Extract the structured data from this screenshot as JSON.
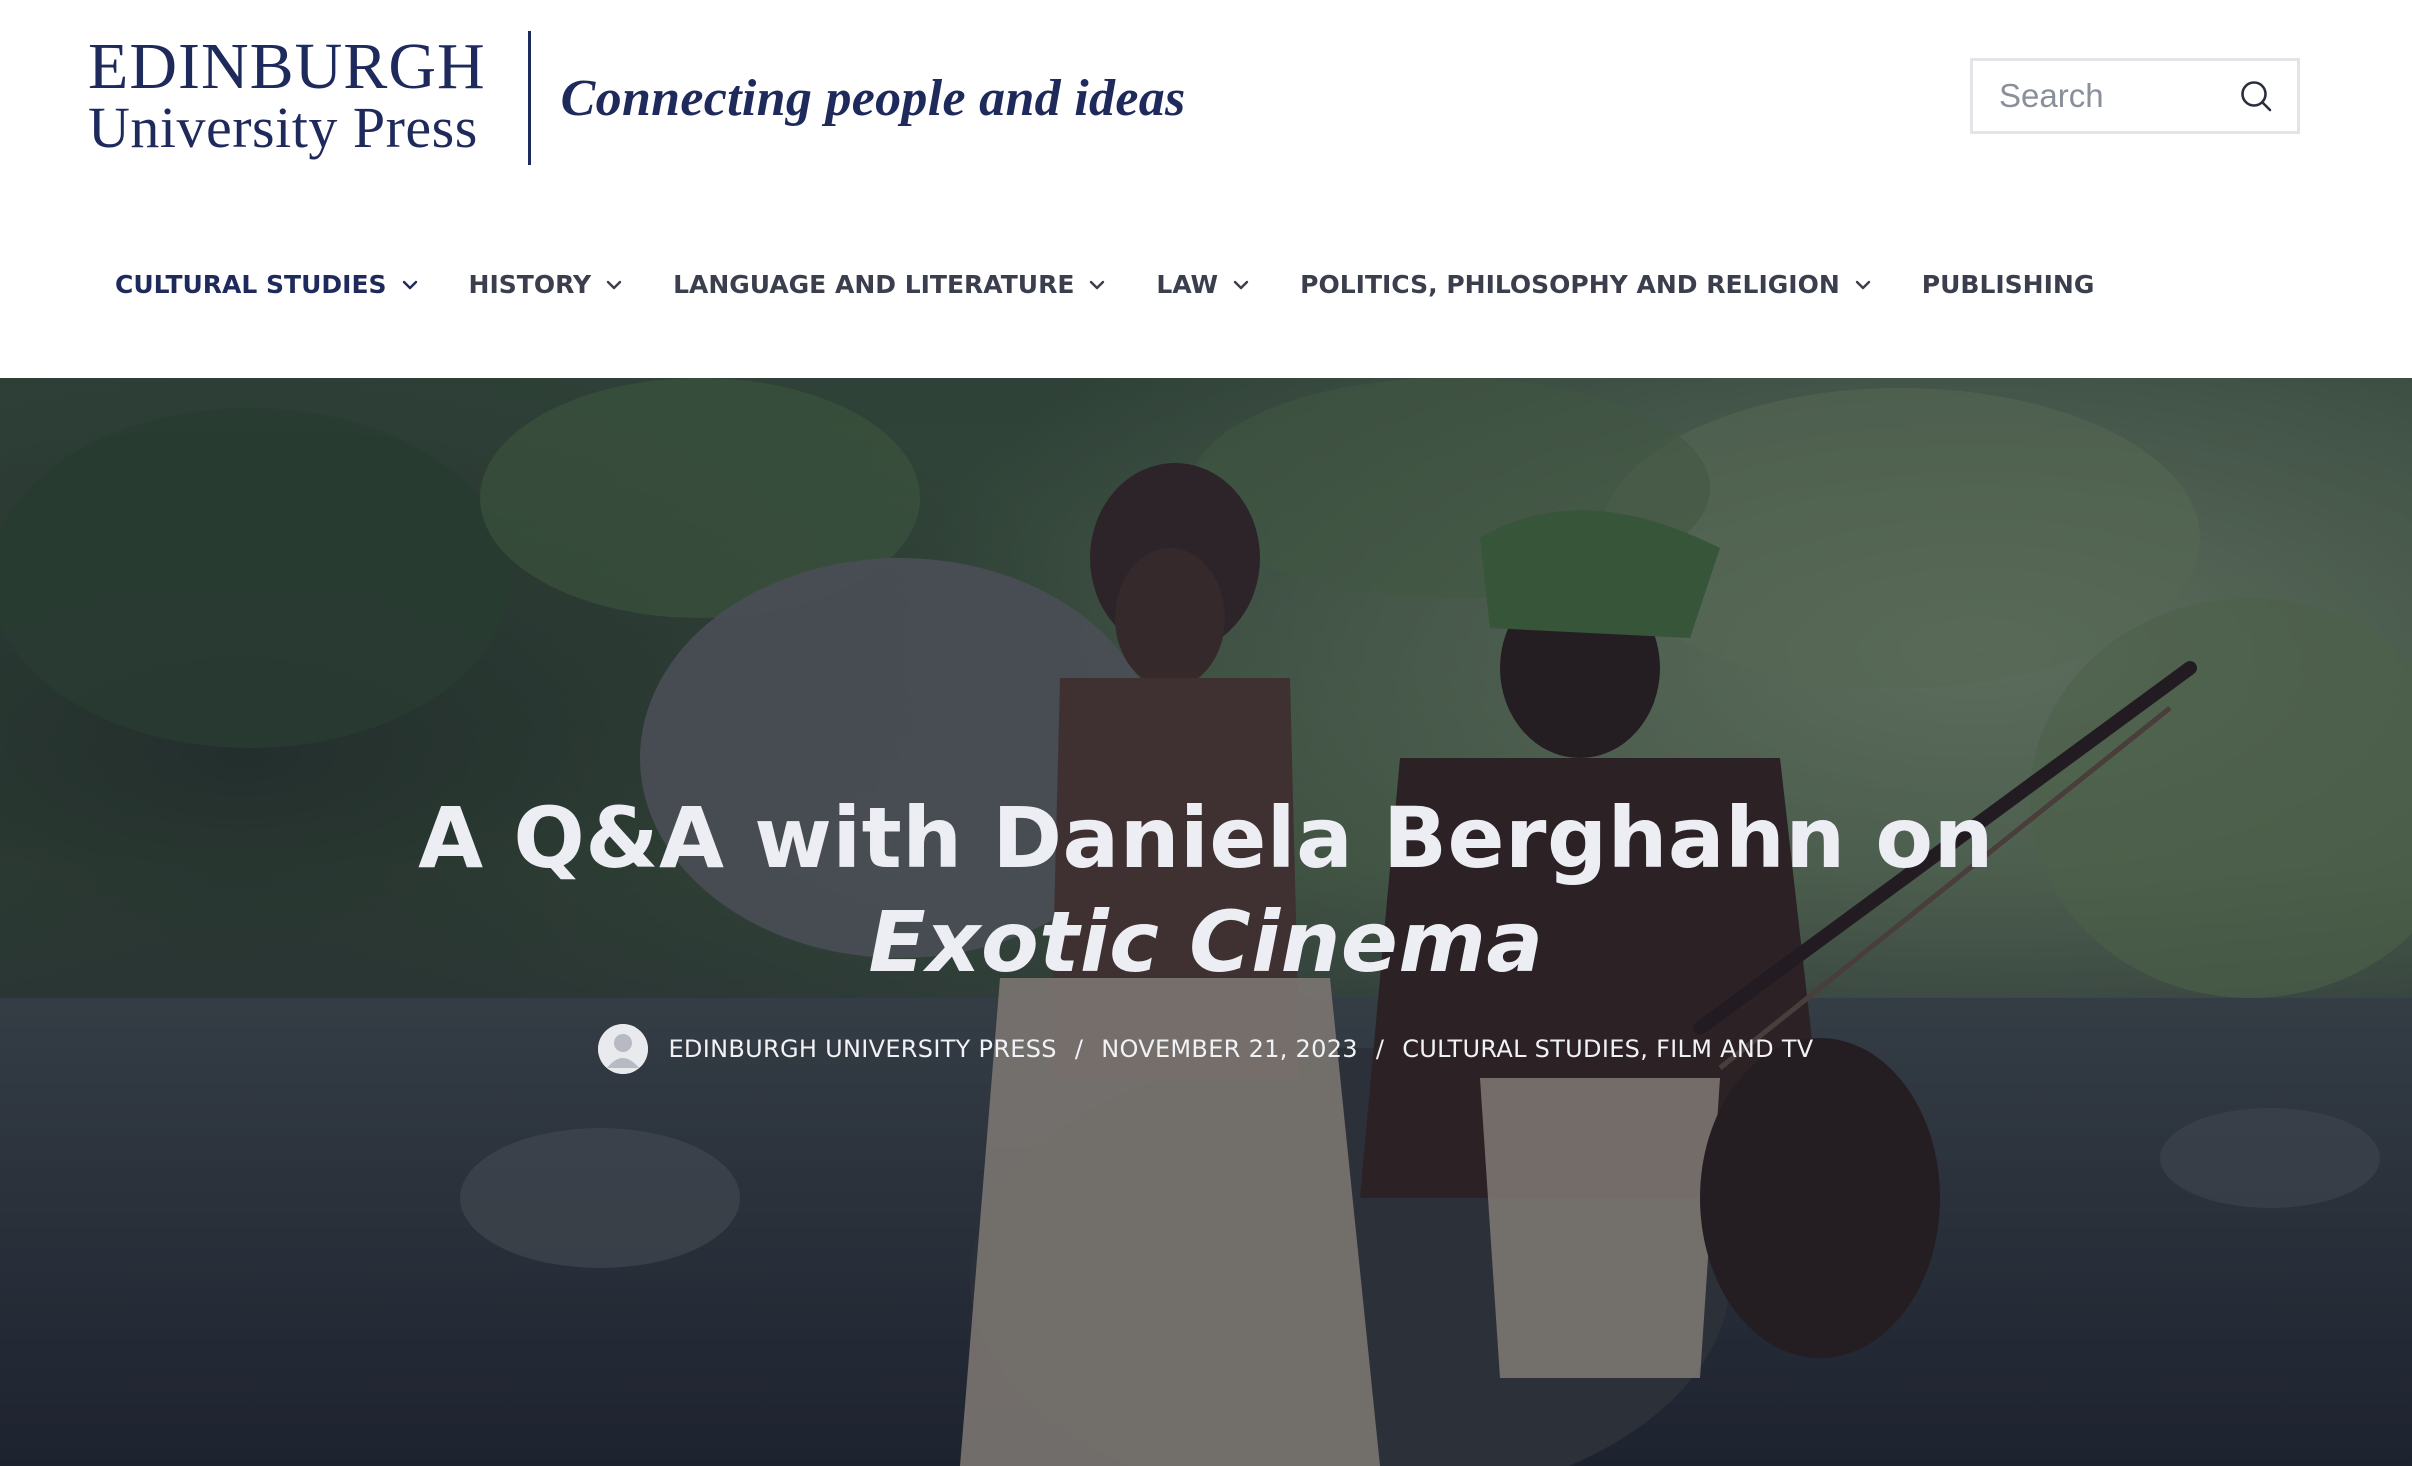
{
  "header": {
    "logo": {
      "line1": "EDINBURGH",
      "line2": "University Press",
      "tagline": "Connecting people and ideas"
    },
    "search": {
      "placeholder": "Search",
      "value": "",
      "icon": "search-icon"
    },
    "nav": [
      {
        "label": "CULTURAL STUDIES",
        "has_dropdown": true,
        "active": true
      },
      {
        "label": "HISTORY",
        "has_dropdown": true,
        "active": false
      },
      {
        "label": "LANGUAGE AND LITERATURE",
        "has_dropdown": true,
        "active": false
      },
      {
        "label": "LAW",
        "has_dropdown": true,
        "active": false
      },
      {
        "label": "POLITICS, PHILOSOPHY AND RELIGION",
        "has_dropdown": true,
        "active": false
      },
      {
        "label": "PUBLISHING",
        "has_dropdown": false,
        "active": false
      }
    ]
  },
  "hero": {
    "title_line1": "A Q&A with Daniela Berghahn on",
    "title_line2_italic": "Exotic Cinema",
    "meta": {
      "author": "EDINBURGH UNIVERSITY PRESS",
      "separator": "/",
      "date": "NOVEMBER 21, 2023",
      "category1": "CULTURAL STUDIES",
      "category_joiner": ",",
      "category2": "FILM AND TV"
    }
  },
  "colors": {
    "brand_navy": "#1f2a5c",
    "nav_text": "#3b3f4d",
    "hero_text": "#eceef3"
  }
}
